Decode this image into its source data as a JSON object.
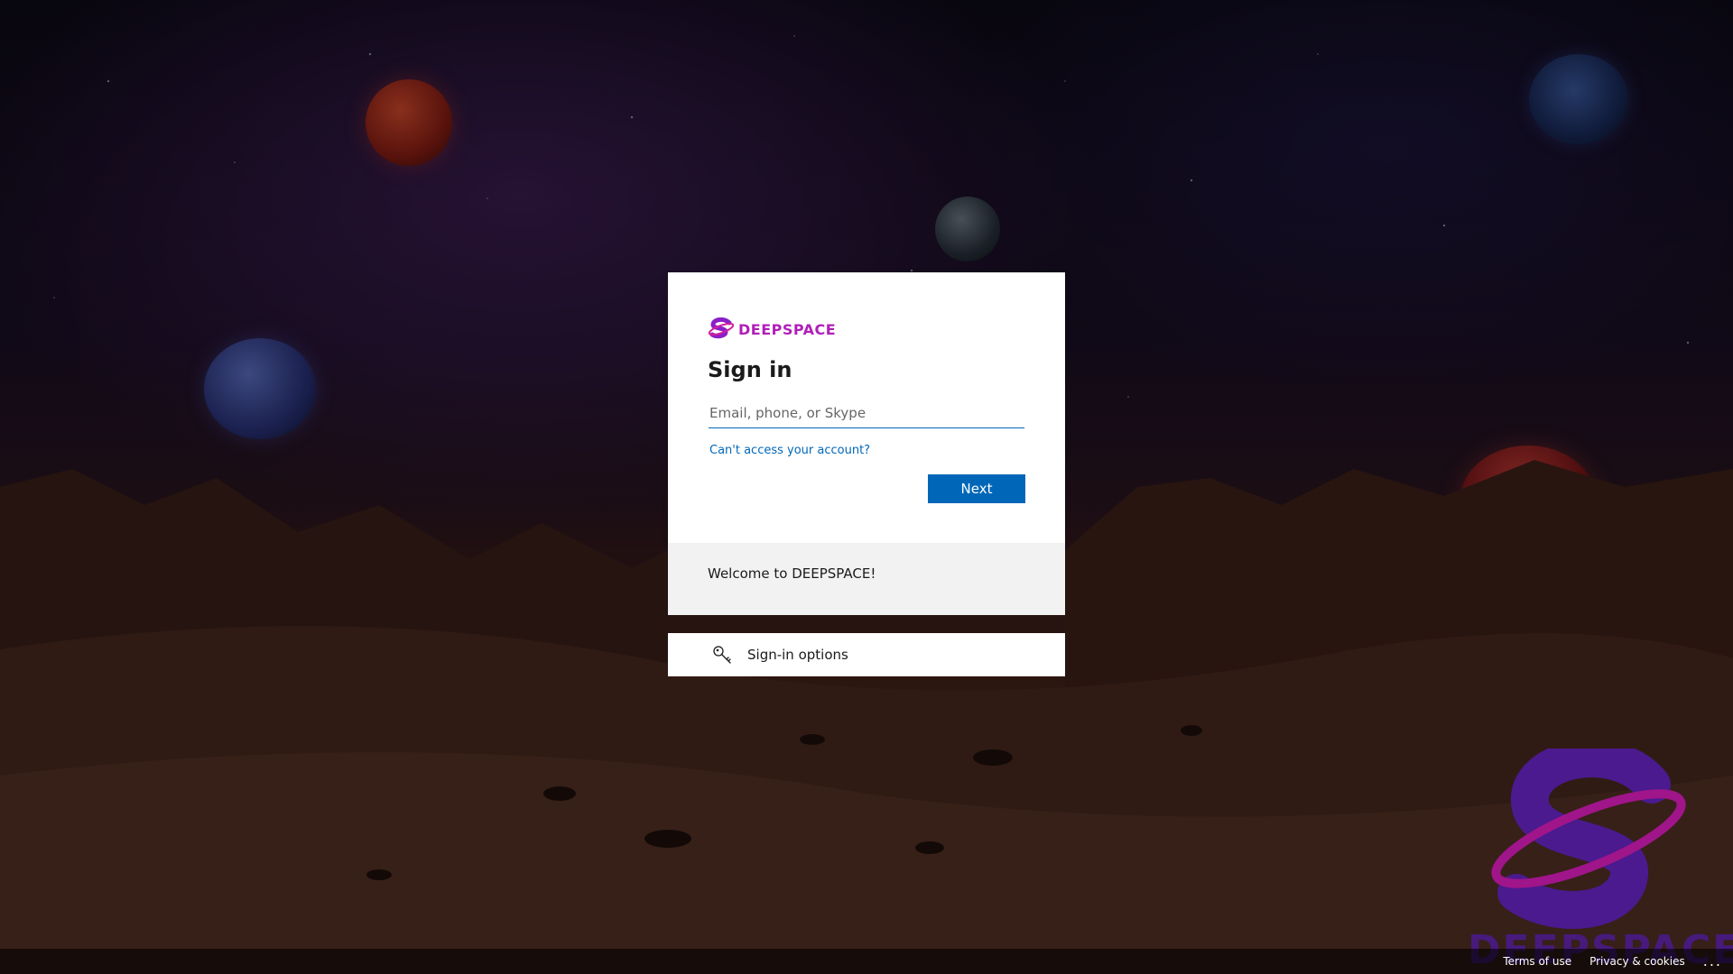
{
  "brand": {
    "logo_text": "DEEPSPACE",
    "watermark_text": "DEEPSPACE",
    "accent_color": "#b01fb8",
    "primary_color": "#0067b8"
  },
  "signin": {
    "title": "Sign in",
    "email_placeholder": "Email, phone, or Skype",
    "email_value": "",
    "cant_access_label": "Can't access your account?",
    "next_label": "Next"
  },
  "welcome": {
    "message": "Welcome to DEEPSPACE!"
  },
  "options": {
    "label": "Sign-in options",
    "icon": "key-icon"
  },
  "footer": {
    "terms_label": "Terms of use",
    "privacy_label": "Privacy & cookies",
    "more_label": "..."
  }
}
